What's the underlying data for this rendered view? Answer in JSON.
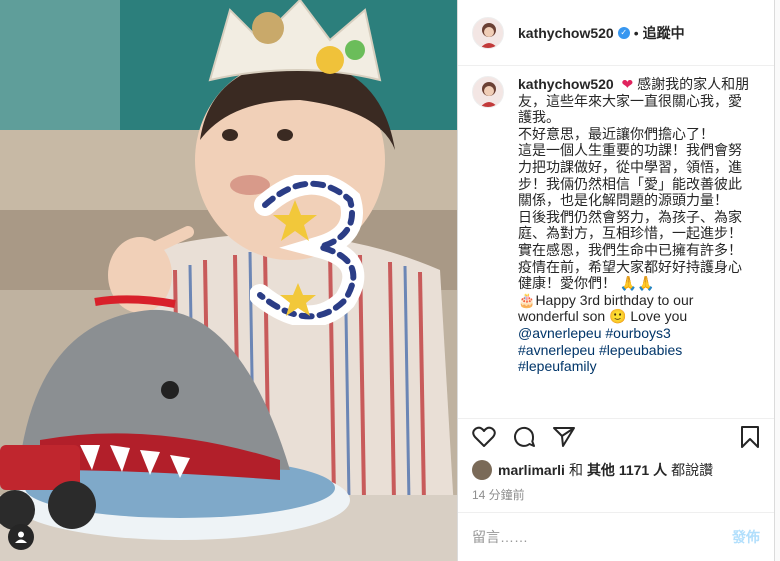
{
  "header": {
    "username": "kathychow520",
    "follow_state": "追蹤中"
  },
  "caption": {
    "username": "kathychow520",
    "text_1": "感謝我的家人和朋友，這些年來大家一直很關心我，愛護我。",
    "text_2": "不好意思，最近讓你們擔心了！",
    "text_3": "這是一個人生重要的功課！我們會努力把功課做好，從中學習，領悟，進步！我倆仍然相信「愛」能改善彼此關係，也是化解問題的源頭力量！",
    "text_4": "日後我們仍然會努力，為孩子、為家庭、為對方，互相珍惜，一起進步！",
    "text_5": "實在感恩，我們生命中已擁有許多！疫情在前，希望大家都好好持護身心健康！愛你們！",
    "emoji_pray": "🙏🙏",
    "cake_emoji": "🎂",
    "birthday_text": "Happy 3rd birthday to our wonderful son",
    "emoji_smile": "🙂",
    "love_text": "Love you",
    "tags": [
      "@avnerlepeu",
      "#ourboys3",
      "#avnerlepeu",
      "#lepeubabies",
      "#lepeufamily"
    ]
  },
  "likes": {
    "liker": "marlimarli",
    "conj": "和",
    "others": "其他 1171 人",
    "suffix": "都說讚"
  },
  "time_ago": "14 分鐘前",
  "comment": {
    "placeholder": "留言……",
    "post_label": "發佈"
  },
  "icons": {
    "heart": "heart-icon",
    "comment": "comment-icon",
    "share": "share-icon",
    "bookmark": "bookmark-icon",
    "user_tag": "user-tag-icon"
  },
  "colors": {
    "link": "#003569",
    "verified": "#3897f0",
    "post_button": "#b2dffc",
    "heart": "#e0245e"
  }
}
